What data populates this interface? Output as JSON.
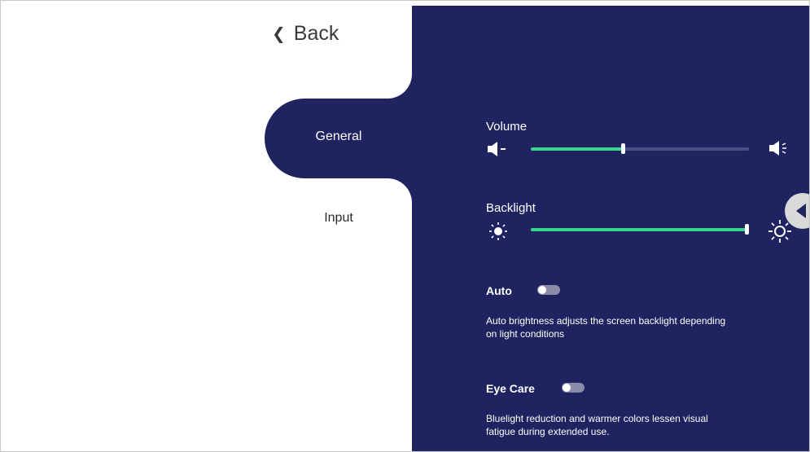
{
  "nav": {
    "back_label": "Back",
    "tabs": [
      {
        "label": "General",
        "selected": true
      },
      {
        "label": "Input",
        "selected": false
      }
    ]
  },
  "settings": {
    "volume": {
      "label": "Volume",
      "level": 0.42
    },
    "backlight": {
      "label": "Backlight",
      "level": 1.0
    },
    "auto": {
      "label": "Auto",
      "on": false,
      "description_line1": "Auto brightness adjusts the screen backlight depending",
      "description_line2": "on light conditions"
    },
    "eye_care": {
      "label": "Eye Care",
      "on": false,
      "description_line1": "Bluelight reduction and warmer colors lessen visual",
      "description_line2": "fatigue during extended use."
    }
  },
  "colors": {
    "panel": "#1f2360",
    "slider_fill": "#37d68f",
    "slider_track": "#4b5080",
    "toggle_off": "#8a8ca8"
  },
  "icons": [
    "chevron-left-icon",
    "volume-down-icon",
    "volume-up-icon",
    "brightness-low-icon",
    "brightness-high-icon",
    "collapse-arrow-icon"
  ]
}
